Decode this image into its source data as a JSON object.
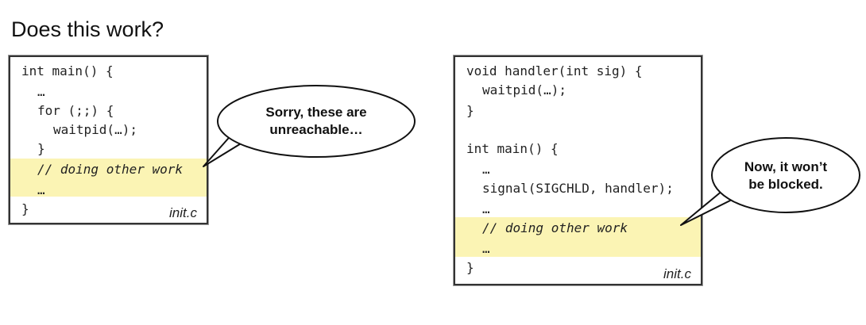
{
  "slide": {
    "title": "Does this work?"
  },
  "left_box": {
    "filename": "init.c",
    "lines": [
      "int main() {",
      "…",
      "for (;;) {",
      "waitpid(…);",
      "}",
      "// doing other work",
      "…",
      "}"
    ],
    "bubble_lines": [
      "Sorry, these are",
      "unreachable…"
    ]
  },
  "right_box": {
    "filename": "init.c",
    "lines": [
      "void handler(int sig) {",
      "waitpid(…);",
      "}",
      "int main() {",
      "…",
      "signal(SIGCHLD, handler);",
      "…",
      "// doing other work",
      "…",
      "}"
    ],
    "bubble_lines": [
      "Now, it won’t",
      "be blocked."
    ]
  },
  "colors": {
    "highlight": "#fbf4b4",
    "border": "#333333"
  }
}
